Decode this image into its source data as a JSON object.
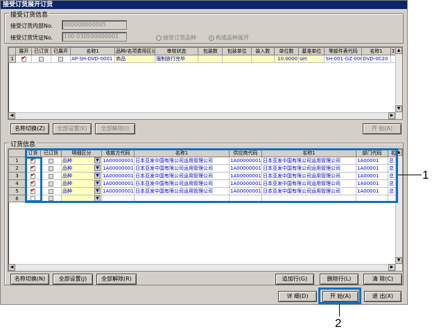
{
  "window": {
    "title": "接受订货展开订货"
  },
  "order_group": {
    "label": "接受订货信息",
    "internal_no_label": "接受订货内部No.",
    "internal_no_value": "000000000005",
    "voucher_no_label": "接受订货凭证No.",
    "voucher_no_value": "100-030500000001",
    "radio1": "接受订货品种",
    "radio2": "构成品种展开"
  },
  "top_grid": {
    "headers": [
      "展开",
      "已订货",
      "已展开",
      "名称1",
      "品种/名项费用区分",
      "审核状态",
      "包装数",
      "包装单位",
      "装入数",
      "单位数",
      "基准单位",
      "零部件表代码",
      "名称1",
      "Σ"
    ],
    "row": {
      "num": "1",
      "name1": "AP-SH-DVD-0001",
      "kind": "商品",
      "status": "强制放行完毕",
      "unit_count": "10.0000",
      "base_unit": "set",
      "parts_code": "SH-001-GZ-000",
      "name1b": "DVD-0C20"
    }
  },
  "top_buttons": {
    "name_switch": "名称切换(Z)",
    "set_all": "全部设置(K)",
    "clear_all": "全部解除(I)",
    "start": "开 始(A)"
  },
  "detail_group": {
    "label": "订货信息"
  },
  "bottom_grid": {
    "headers": [
      "",
      "订货",
      "已订货",
      "明细区分",
      "收款方代码",
      "名称1",
      "供应商代码",
      "名称1",
      "部门代码",
      "名"
    ],
    "rows": [
      {
        "num": "1",
        "kind": "品种",
        "code": "1A00000001",
        "name": "日本亚发中国有限公司运用管理公司",
        "sup": "1A00000001",
        "sname": "日本亚发中国有限公司运用管理公司",
        "dept": "1A00001",
        "x": "总"
      },
      {
        "num": "2",
        "kind": "品种",
        "code": "1A00000001",
        "name": "日本亚发中国有限公司运用管理公司",
        "sup": "1A00000001",
        "sname": "日本亚发中国有限公司运用管理公司",
        "dept": "1A00001",
        "x": "总"
      },
      {
        "num": "3",
        "kind": "品种",
        "code": "1A00000001",
        "name": "日本亚发中国有限公司运用管理公司",
        "sup": "1A00000001",
        "sname": "日本亚发中国有限公司运用管理公司",
        "dept": "1A00001",
        "x": "总"
      },
      {
        "num": "4",
        "kind": "品种",
        "code": "1A00000001",
        "name": "日本亚发中国有限公司运用管理公司",
        "sup": "1A00000001",
        "sname": "日本亚发中国有限公司运用管理公司",
        "dept": "1A00001",
        "x": "总"
      },
      {
        "num": "5",
        "kind": "品种",
        "code": "1A00000001",
        "name": "日本亚发中国有限公司运用管理公司",
        "sup": "1A00000001",
        "sname": "日本亚发中国有限公司运用管理公司",
        "dept": "1A00001",
        "x": "总"
      },
      {
        "num": "6",
        "kind": "",
        "code": "",
        "name": "",
        "sup": "",
        "sname": "",
        "dept": "",
        "x": ""
      }
    ]
  },
  "bottom_buttons": {
    "name_switch": "名称切换(N)",
    "set_all": "全部设置(J)",
    "clear_all": "全部解除(R)",
    "add_row": "追加行(G)",
    "del_row": "删除行(L)",
    "clear": "清 除(C)"
  },
  "footer_buttons": {
    "detail": "详 细(D)",
    "start": "开 始(A)",
    "exit": "退 出(X)"
  },
  "callouts": {
    "one": "1",
    "two": "2"
  },
  "colors": {
    "callout": "#0f6fc6",
    "title_bar": "#0a246a"
  }
}
